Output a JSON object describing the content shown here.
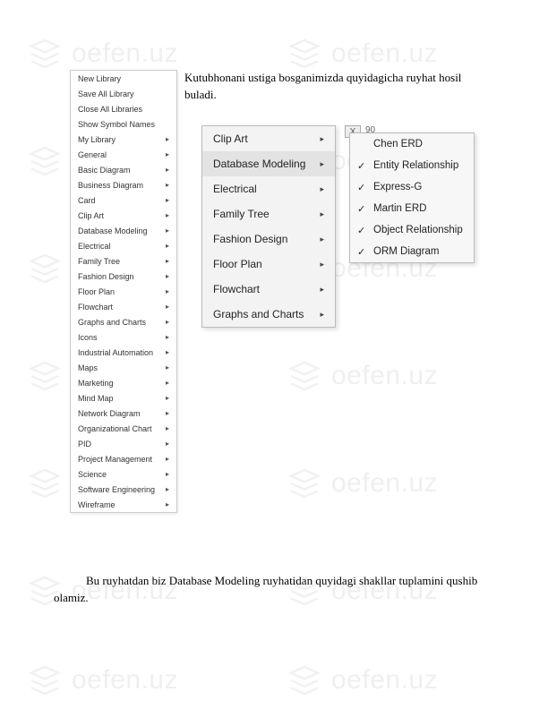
{
  "watermark": "oefen.uz",
  "paragraph1": "Kutubhonani ustiga bosganimizda quyidagicha ruyhat hosil buladi.",
  "paragraph2": "Bu ruyhatdan biz Database Modeling ruyhatidan quyidagi shakllar tuplamini qushib olamiz.",
  "closeLabel": "X",
  "rulerNum": "90",
  "mainMenu": [
    {
      "label": "New Library",
      "arrow": false
    },
    {
      "label": "Save All Library",
      "arrow": false
    },
    {
      "label": "Close All Libraries",
      "arrow": false
    },
    {
      "label": "Show Symbol Names",
      "arrow": false
    },
    {
      "label": "My Library",
      "arrow": true
    },
    {
      "label": "General",
      "arrow": true
    },
    {
      "label": "Basic Diagram",
      "arrow": true
    },
    {
      "label": "Business Diagram",
      "arrow": true
    },
    {
      "label": "Card",
      "arrow": true
    },
    {
      "label": "Clip Art",
      "arrow": true
    },
    {
      "label": "Database Modeling",
      "arrow": true
    },
    {
      "label": "Electrical",
      "arrow": true
    },
    {
      "label": "Family Tree",
      "arrow": true
    },
    {
      "label": "Fashion Design",
      "arrow": true
    },
    {
      "label": "Floor Plan",
      "arrow": true
    },
    {
      "label": "Flowchart",
      "arrow": true
    },
    {
      "label": "Graphs and Charts",
      "arrow": true
    },
    {
      "label": "Icons",
      "arrow": true
    },
    {
      "label": "Industrial Automation",
      "arrow": true
    },
    {
      "label": "Maps",
      "arrow": true
    },
    {
      "label": "Marketing",
      "arrow": true
    },
    {
      "label": "Mind Map",
      "arrow": true
    },
    {
      "label": "Network Diagram",
      "arrow": true
    },
    {
      "label": "Organizational Chart",
      "arrow": true
    },
    {
      "label": "PID",
      "arrow": true
    },
    {
      "label": "Project Management",
      "arrow": true
    },
    {
      "label": "Science",
      "arrow": true
    },
    {
      "label": "Software Engineering",
      "arrow": true
    },
    {
      "label": "Wireframe",
      "arrow": true
    }
  ],
  "subMenu": [
    {
      "label": "Clip Art",
      "arrow": true,
      "highlighted": false
    },
    {
      "label": "Database Modeling",
      "arrow": true,
      "highlighted": true
    },
    {
      "label": "Electrical",
      "arrow": true,
      "highlighted": false
    },
    {
      "label": "Family Tree",
      "arrow": true,
      "highlighted": false
    },
    {
      "label": "Fashion Design",
      "arrow": true,
      "highlighted": false
    },
    {
      "label": "Floor Plan",
      "arrow": true,
      "highlighted": false
    },
    {
      "label": "Flowchart",
      "arrow": true,
      "highlighted": false
    },
    {
      "label": "Graphs and Charts",
      "arrow": true,
      "highlighted": false
    }
  ],
  "subSubMenu": [
    {
      "label": "Chen ERD",
      "checked": false
    },
    {
      "label": "Entity Relationship",
      "checked": true
    },
    {
      "label": "Express-G",
      "checked": true
    },
    {
      "label": "Martin ERD",
      "checked": true
    },
    {
      "label": "Object Relationship",
      "checked": true
    },
    {
      "label": "ORM Diagram",
      "checked": true
    }
  ]
}
